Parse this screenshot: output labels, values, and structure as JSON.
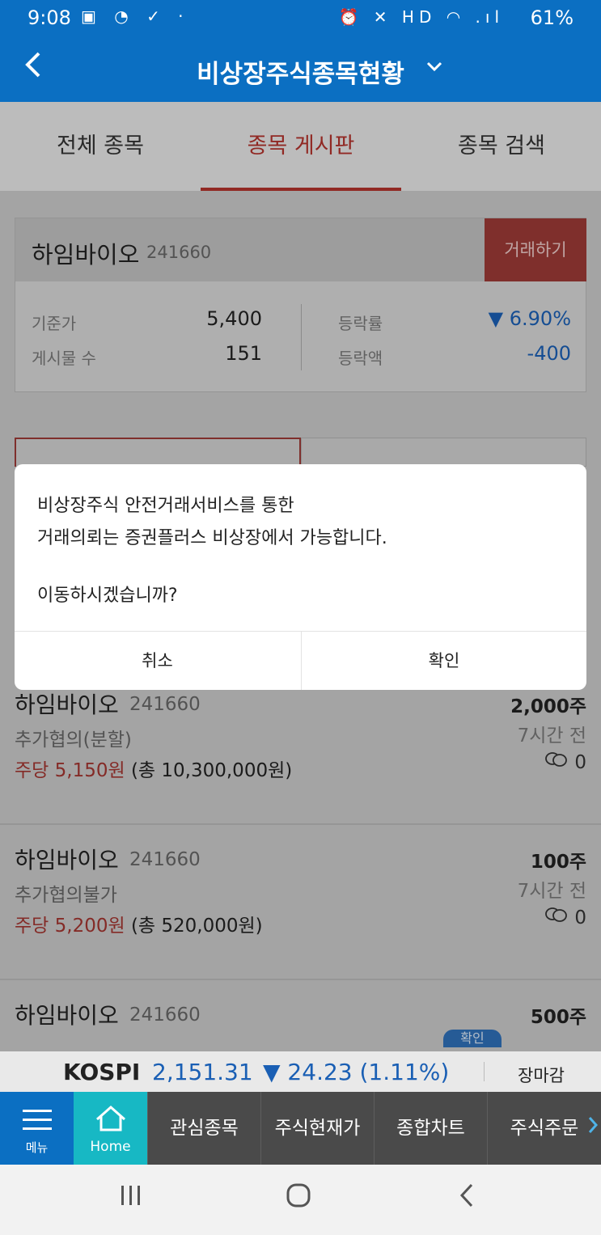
{
  "status": {
    "time": "9:08",
    "battery": "61%",
    "left_icons": "▣ ◔ ✓ ·",
    "right_icons": "⏰ ✕ HD ◠ .ıl"
  },
  "header": {
    "title": "비상장주식종목현황",
    "back_icon": "back-arrow-icon",
    "dropdown_icon": "chevron-down-icon"
  },
  "tabs": [
    {
      "label": "전체 종목"
    },
    {
      "label": "종목 게시판"
    },
    {
      "label": "종목 검색"
    }
  ],
  "active_tab": 1,
  "stock": {
    "name": "하임바이오",
    "code": "241660",
    "trade_label": "거래하기",
    "base_price_label": "기준가",
    "base_price": "5,400",
    "posts_label": "게시물 수",
    "posts": "151",
    "change_rate_label": "등락률",
    "change_rate": "▼ 6.90%",
    "change_amount_label": "등락액",
    "change_amount": "-400"
  },
  "posts": [
    {
      "name": "하임바이오",
      "code": "241660",
      "condition": "추가협의(분할)",
      "price_red": "주당 5,150원",
      "total": " (총 10,300,000원)",
      "qty": "2,000주",
      "ago": "7시간 전",
      "comments": "0"
    },
    {
      "name": "하임바이오",
      "code": "241660",
      "condition": "추가협의불가",
      "price_red": "주당 5,200원",
      "total": " (총 520,000원)",
      "qty": "100주",
      "ago": "7시간 전",
      "comments": "0"
    },
    {
      "name": "하임바이오",
      "code": "241660",
      "condition": "",
      "price_red": "",
      "total": "",
      "qty": "500주",
      "ago": "",
      "comments": "",
      "badge": "확인"
    }
  ],
  "dialog": {
    "line1": "비상장주식 안전거래서비스를 통한",
    "line2": "거래의뢰는 증권플러스 비상장에서 가능합니다.",
    "question": "이동하시겠습니까?",
    "cancel": "취소",
    "confirm": "확인"
  },
  "ticker": {
    "name": "KOSPI",
    "value": "2,151.31",
    "change": "▼ 24.23 (1.11%)",
    "market_status": "장마감"
  },
  "bottom_nav": {
    "menu_label": "메뉴",
    "home_label": "Home",
    "items": [
      "관심종목",
      "주식현재가",
      "종합차트",
      "주식주문"
    ]
  },
  "colors": {
    "primary": "#0b6fc2",
    "accent_red": "#b1322c",
    "down_blue": "#1a5fb4",
    "home_teal": "#17b8c4"
  }
}
